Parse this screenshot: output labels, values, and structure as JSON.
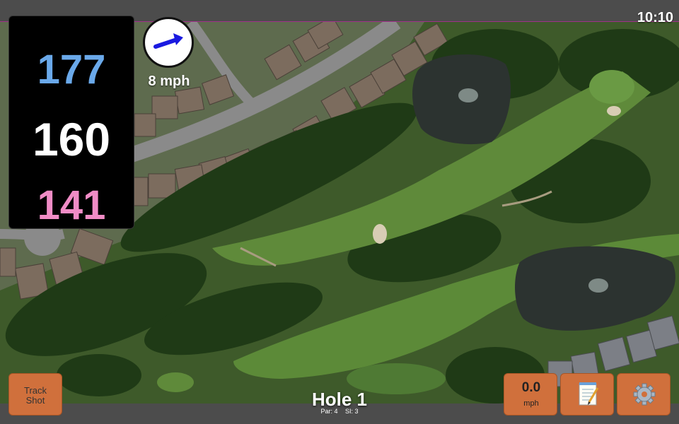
{
  "status": {
    "time": "10:10"
  },
  "distances": {
    "back": "177",
    "middle": "160",
    "front": "141"
  },
  "distance_colors": {
    "back": "#6aa9ea",
    "middle": "#ffffff",
    "front": "#f08cc6"
  },
  "wind": {
    "speed": "8 mph",
    "arrow_icon": "wind-direction-arrow-icon",
    "arrow_color": "#1a1ae0"
  },
  "buttons": {
    "track_shot": "Track\nShot",
    "speed_value": "0.0",
    "speed_unit": "mph",
    "notes_icon": "notepad-icon",
    "settings_icon": "gear-icon",
    "accent": "#d0703c"
  },
  "hole": {
    "title": "Hole 1",
    "par": "Par: 4",
    "si": "SI: 3"
  },
  "map": {
    "type": "aerial satellite view of golf hole"
  }
}
